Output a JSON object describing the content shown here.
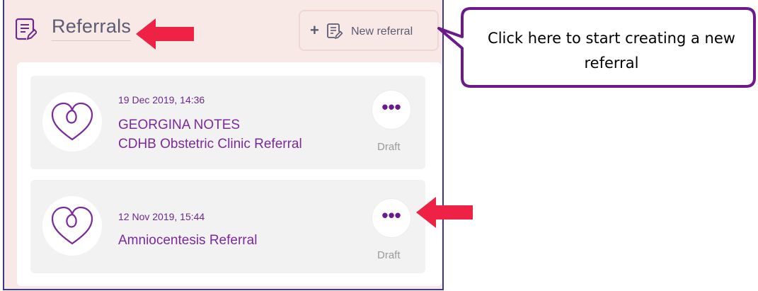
{
  "header": {
    "title": "Referrals",
    "icon": "document-edit-icon"
  },
  "new_referral_button": {
    "plus": "+",
    "icon": "document-edit-icon",
    "label": "New referral"
  },
  "referrals": [
    {
      "date": "19 Dec 2019, 14:36",
      "lines": [
        "GEORGINA NOTES",
        "CDHB Obstetric Clinic Referral"
      ],
      "status": "Draft",
      "more": "•••",
      "icon": "heart-icon"
    },
    {
      "date": "12 Nov 2019, 15:44",
      "lines": [
        "Amniocentesis Referral"
      ],
      "status": "Draft",
      "more": "•••",
      "icon": "heart-icon"
    }
  ],
  "callout": {
    "text": "Click here to start creating a new referral"
  },
  "colors": {
    "panel_bg": "#f9e9e6",
    "accent_purple": "#7a2a9a",
    "annotation_red": "#ee2244",
    "callout_border": "#6a1a8a"
  }
}
